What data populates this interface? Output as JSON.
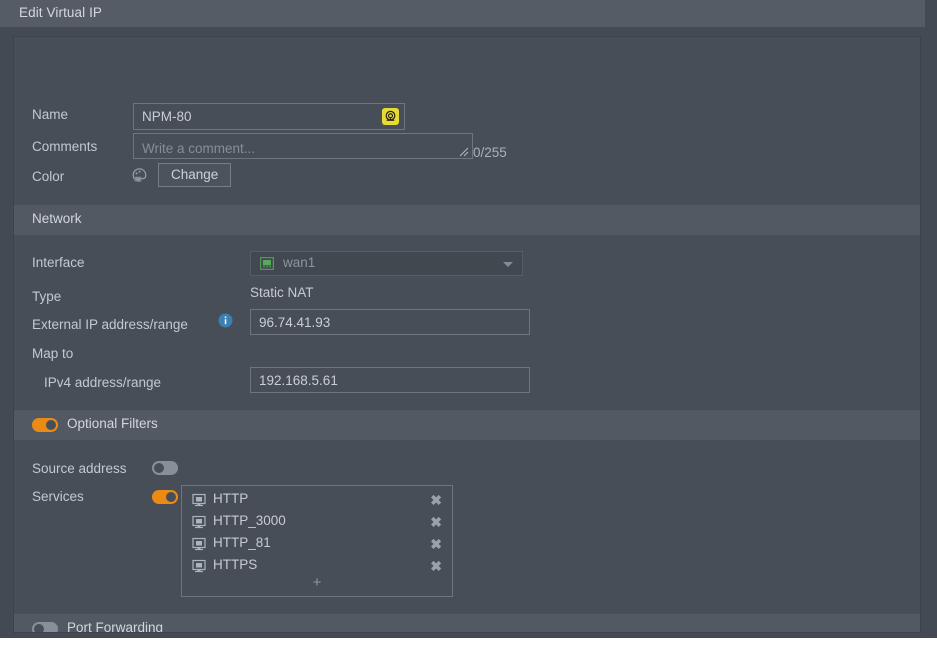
{
  "window": {
    "title": "Edit Virtual IP"
  },
  "form": {
    "name": {
      "label": "Name",
      "value": "NPM-80",
      "badge_icon": "referenced-object-icon"
    },
    "comments": {
      "label": "Comments",
      "value": "",
      "placeholder": "Write a comment...",
      "counter": "0/255"
    },
    "color": {
      "label": "Color",
      "swatch_icon": "color-palette-icon",
      "change_label": "Change"
    }
  },
  "network": {
    "section_title": "Network",
    "interface": {
      "label": "Interface",
      "value": "wan1",
      "icon": "ethernet-port-icon",
      "disabled": true
    },
    "type": {
      "label": "Type",
      "value": "Static NAT"
    },
    "external_ip": {
      "label": "External IP address/range",
      "value": "96.74.41.93",
      "info_icon": "info-icon"
    },
    "map_to": {
      "label": "Map to"
    },
    "ipv4": {
      "label": "IPv4 address/range",
      "value": "192.168.5.61"
    }
  },
  "optional_filters": {
    "section_title": "Optional Filters",
    "enabled": true,
    "source_address": {
      "label": "Source address",
      "enabled": false
    },
    "services": {
      "label": "Services",
      "enabled": true,
      "items": [
        {
          "name": "HTTP",
          "icon": "service-icon",
          "remove": "✖"
        },
        {
          "name": "HTTP_3000",
          "icon": "service-icon",
          "remove": "✖"
        },
        {
          "name": "HTTP_81",
          "icon": "service-icon",
          "remove": "✖"
        },
        {
          "name": "HTTPS",
          "icon": "service-icon",
          "remove": "✖"
        }
      ],
      "add_label": "+"
    }
  },
  "port_forwarding": {
    "section_title": "Port Forwarding",
    "enabled": false
  },
  "colors": {
    "accent": "#eb8b15",
    "badge": "#e8dc34",
    "info": "#3c7fb1",
    "panel": "#474e58",
    "band": "#525962",
    "titlebar": "#565c66",
    "body": "#434a54"
  }
}
